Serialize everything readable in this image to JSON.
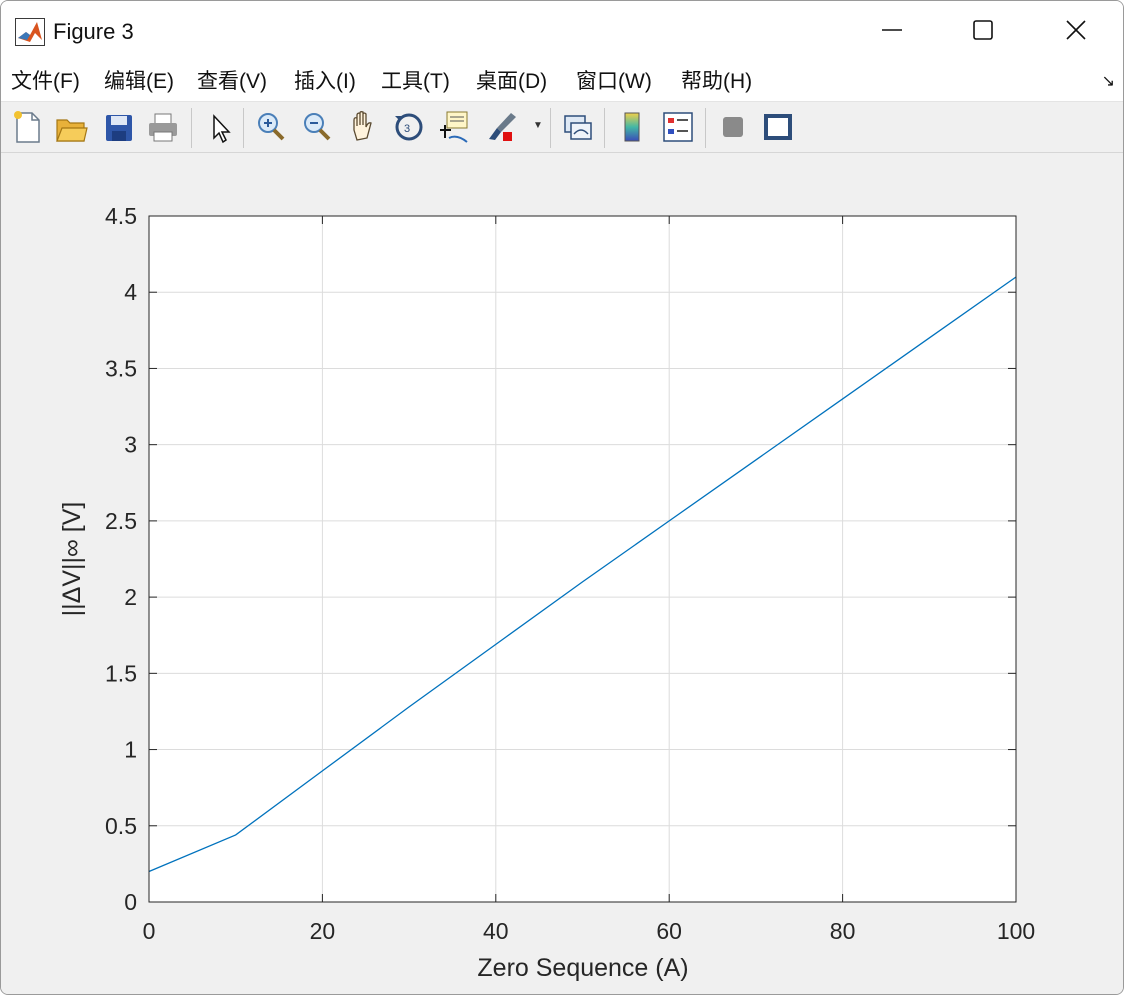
{
  "window": {
    "title": "Figure 3"
  },
  "menu": {
    "items": [
      "文件(F)",
      "编辑(E)",
      "查看(V)",
      "插入(I)",
      "工具(T)",
      "桌面(D)",
      "窗口(W)",
      "帮助(H)"
    ]
  },
  "toolbar": {
    "icons": [
      "new-file-icon",
      "open-folder-icon",
      "save-icon",
      "print-icon",
      "pointer-icon",
      "zoom-in-icon",
      "zoom-out-icon",
      "pan-icon",
      "rotate-3d-icon",
      "data-cursor-icon",
      "brush-icon",
      "link-plot-icon",
      "colorbar-icon",
      "legend-icon",
      "hide-plot-tools-icon",
      "show-plot-tools-icon"
    ]
  },
  "chart_data": {
    "type": "line",
    "xlabel": "Zero Sequence (A)",
    "ylabel": "||ΔV||∞ [V]",
    "xlim": [
      0,
      100
    ],
    "ylim": [
      0,
      4.5
    ],
    "xticks": [
      "0",
      "20",
      "40",
      "60",
      "80",
      "100"
    ],
    "yticks": [
      "0",
      "0.5",
      "1",
      "1.5",
      "2",
      "2.5",
      "3",
      "3.5",
      "4",
      "4.5"
    ],
    "grid": true,
    "series": [
      {
        "color": "#0072bd",
        "x": [
          0,
          10,
          20,
          30,
          40,
          50,
          60,
          70,
          80,
          90,
          100
        ],
        "y": [
          0.2,
          0.44,
          0.86,
          1.28,
          1.69,
          2.1,
          2.5,
          2.9,
          3.3,
          3.7,
          4.1
        ]
      }
    ]
  }
}
